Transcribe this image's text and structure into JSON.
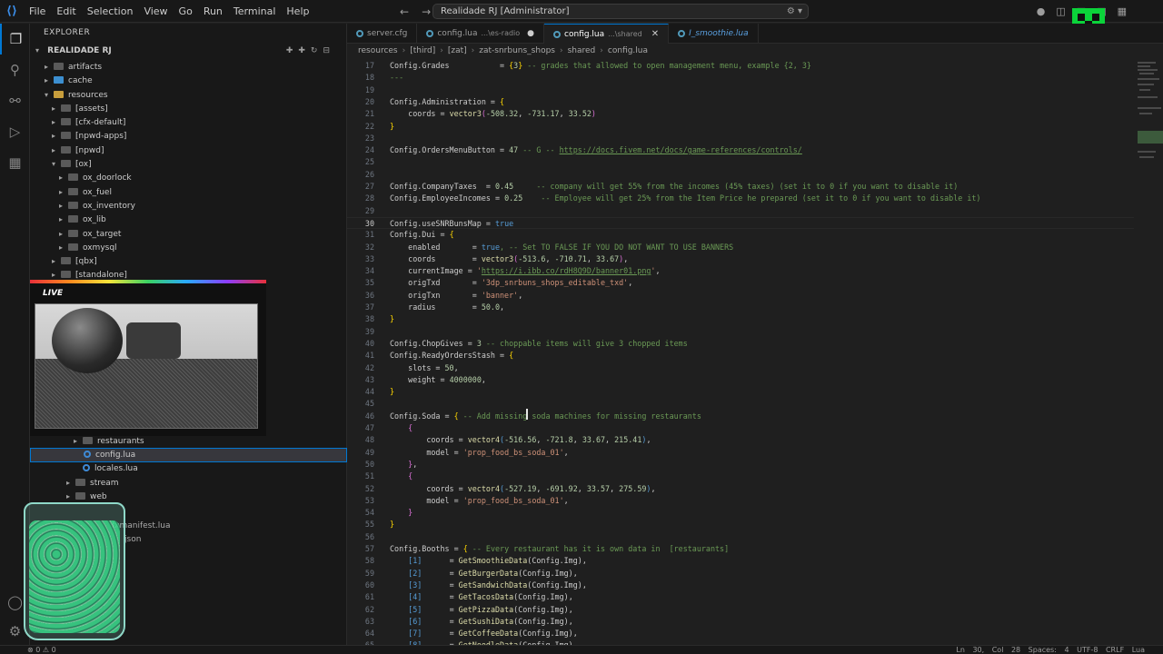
{
  "menu": [
    "File",
    "Edit",
    "Selection",
    "View",
    "Go",
    "Run",
    "Terminal",
    "Help"
  ],
  "window_title": "Realidade RJ [Administrator]",
  "explorer": {
    "title": "EXPLORER",
    "root": "REALIDADE RJ",
    "items": [
      {
        "label": "artifacts",
        "depth": 1,
        "kind": "folder",
        "open": false
      },
      {
        "label": "cache",
        "depth": 1,
        "kind": "folder-blue",
        "open": false
      },
      {
        "label": "resources",
        "depth": 1,
        "kind": "folder-open",
        "open": true
      },
      {
        "label": "[assets]",
        "depth": 2,
        "kind": "folder",
        "open": false
      },
      {
        "label": "[cfx-default]",
        "depth": 2,
        "kind": "folder",
        "open": false
      },
      {
        "label": "[npwd-apps]",
        "depth": 2,
        "kind": "folder",
        "open": false
      },
      {
        "label": "[npwd]",
        "depth": 2,
        "kind": "folder",
        "open": false
      },
      {
        "label": "[ox]",
        "depth": 2,
        "kind": "folder",
        "open": true
      },
      {
        "label": "ox_doorlock",
        "depth": 3,
        "kind": "folder",
        "open": false
      },
      {
        "label": "ox_fuel",
        "depth": 3,
        "kind": "folder",
        "open": false
      },
      {
        "label": "ox_inventory",
        "depth": 3,
        "kind": "folder",
        "open": false
      },
      {
        "label": "ox_lib",
        "depth": 3,
        "kind": "folder",
        "open": false
      },
      {
        "label": "ox_target",
        "depth": 3,
        "kind": "folder",
        "open": false
      },
      {
        "label": "oxmysql",
        "depth": 3,
        "kind": "folder",
        "open": false
      },
      {
        "label": "[qbx]",
        "depth": 2,
        "kind": "folder",
        "open": false
      },
      {
        "label": "[standalone]",
        "depth": 2,
        "kind": "folder",
        "open": false
      }
    ],
    "lower_items": [
      {
        "label": "restaurants",
        "depth": 5,
        "kind": "folder",
        "selected": false
      },
      {
        "label": "config.lua",
        "depth": 5,
        "kind": "lua",
        "selected": true
      },
      {
        "label": "locales.lua",
        "depth": 5,
        "kind": "lua",
        "selected": false
      },
      {
        "label": "stream",
        "depth": 4,
        "kind": "folder",
        "selected": false
      },
      {
        "label": "web",
        "depth": 4,
        "kind": "folder",
        "selected": false
      }
    ],
    "partial_items": [
      "fxmanifest.lua",
      "json"
    ]
  },
  "webcam": {
    "label": "LIVE"
  },
  "tabs": [
    {
      "name": "server.cfg",
      "sub": "",
      "active": false,
      "modified": false,
      "preview": false
    },
    {
      "name": "config.lua",
      "sub": "...\\es-radio",
      "active": false,
      "modified": true,
      "preview": false
    },
    {
      "name": "config.lua",
      "sub": "...\\shared",
      "active": true,
      "modified": false,
      "preview": false
    },
    {
      "name": "I_smoothie.lua",
      "sub": "",
      "active": false,
      "modified": false,
      "preview": true
    }
  ],
  "breadcrumbs": [
    "resources",
    "[third]",
    "[zat]",
    "zat-snrbuns_shops",
    "shared",
    "config.lua"
  ],
  "current_line": 30,
  "code": [
    {
      "n": 17,
      "t": [
        [
          "Config.Grades           = ",
          "k"
        ],
        [
          "{",
          "br"
        ],
        [
          "3",
          "n"
        ],
        [
          "}",
          "br"
        ],
        [
          " -- grades that allowed to open management menu, example {2, 3}",
          "c"
        ]
      ]
    },
    {
      "n": 18,
      "t": [
        [
          "---",
          "c"
        ]
      ]
    },
    {
      "n": 19,
      "t": []
    },
    {
      "n": 20,
      "t": [
        [
          "Config.Administration = ",
          "k"
        ],
        [
          "{",
          "br"
        ]
      ]
    },
    {
      "n": 21,
      "t": [
        [
          "    coords = ",
          "k"
        ],
        [
          "vector3",
          "f"
        ],
        [
          "(",
          "bp"
        ],
        [
          "-508.32",
          "n"
        ],
        [
          ", ",
          "k"
        ],
        [
          "-731.17",
          "n"
        ],
        [
          ", ",
          "k"
        ],
        [
          "33.52",
          "n"
        ],
        [
          ")",
          "bp"
        ]
      ]
    },
    {
      "n": 22,
      "t": [
        [
          "}",
          "br"
        ]
      ]
    },
    {
      "n": 23,
      "t": []
    },
    {
      "n": 24,
      "t": [
        [
          "Config.OrdersMenuButton = ",
          "k"
        ],
        [
          "47",
          "n"
        ],
        [
          " -- G -- ",
          "c"
        ],
        [
          "https://docs.fivem.net/docs/game-references/controls/",
          "l"
        ]
      ]
    },
    {
      "n": 25,
      "t": []
    },
    {
      "n": 26,
      "t": []
    },
    {
      "n": 27,
      "t": [
        [
          "Config.CompanyTaxes  = ",
          "k"
        ],
        [
          "0.45",
          "n"
        ],
        [
          "     -- company will get 55% from the incomes (45% taxes) (set it to 0 if you want to disable it)",
          "c"
        ]
      ]
    },
    {
      "n": 28,
      "t": [
        [
          "Config.EmployeeIncomes = ",
          "k"
        ],
        [
          "0.25",
          "n"
        ],
        [
          "    -- Employee will get 25% from the Item Price he prepared (set it to 0 if you want to disable it)",
          "c"
        ]
      ]
    },
    {
      "n": 29,
      "t": []
    },
    {
      "n": 30,
      "t": [
        [
          "Config.useSNRBunsMap = ",
          "k"
        ],
        [
          "true",
          "b"
        ]
      ]
    },
    {
      "n": 31,
      "t": [
        [
          "Config.Dui = ",
          "k"
        ],
        [
          "{",
          "br"
        ]
      ]
    },
    {
      "n": 32,
      "t": [
        [
          "    enabled       = ",
          "k"
        ],
        [
          "true",
          "b"
        ],
        [
          ", -- Set TO FALSE IF YOU DO NOT WANT TO USE BANNERS",
          "c"
        ]
      ]
    },
    {
      "n": 33,
      "t": [
        [
          "    coords        = ",
          "k"
        ],
        [
          "vector3",
          "f"
        ],
        [
          "(",
          "bp"
        ],
        [
          "-513.6",
          "n"
        ],
        [
          ", ",
          "k"
        ],
        [
          "-710.71",
          "n"
        ],
        [
          ", ",
          "k"
        ],
        [
          "33.67",
          "n"
        ],
        [
          ")",
          "bp"
        ],
        [
          ",",
          "k"
        ]
      ]
    },
    {
      "n": 34,
      "t": [
        [
          "    currentImage = ",
          "k"
        ],
        [
          "'",
          "s"
        ],
        [
          "https://i.ibb.co/rdH8Q9D/banner01.png",
          "l"
        ],
        [
          "'",
          "s"
        ],
        [
          ",",
          "k"
        ]
      ]
    },
    {
      "n": 35,
      "t": [
        [
          "    origTxd       = ",
          "k"
        ],
        [
          "'3dp_snrbuns_shops_editable_txd'",
          "s"
        ],
        [
          ",",
          "k"
        ]
      ]
    },
    {
      "n": 36,
      "t": [
        [
          "    origTxn       = ",
          "k"
        ],
        [
          "'banner'",
          "s"
        ],
        [
          ",",
          "k"
        ]
      ]
    },
    {
      "n": 37,
      "t": [
        [
          "    radius        = ",
          "k"
        ],
        [
          "50.0",
          "n"
        ],
        [
          ",",
          "k"
        ]
      ]
    },
    {
      "n": 38,
      "t": [
        [
          "}",
          "br"
        ]
      ]
    },
    {
      "n": 39,
      "t": []
    },
    {
      "n": 40,
      "t": [
        [
          "Config.ChopGives = ",
          "k"
        ],
        [
          "3",
          "n"
        ],
        [
          " -- choppable items will give 3 chopped items",
          "c"
        ]
      ]
    },
    {
      "n": 41,
      "t": [
        [
          "Config.ReadyOrdersStash = ",
          "k"
        ],
        [
          "{",
          "br"
        ]
      ]
    },
    {
      "n": 42,
      "t": [
        [
          "    slots = ",
          "k"
        ],
        [
          "50",
          "n"
        ],
        [
          ",",
          "k"
        ]
      ]
    },
    {
      "n": 43,
      "t": [
        [
          "    weight = ",
          "k"
        ],
        [
          "4000000",
          "n"
        ],
        [
          ",",
          "k"
        ]
      ]
    },
    {
      "n": 44,
      "t": [
        [
          "}",
          "br"
        ]
      ]
    },
    {
      "n": 45,
      "t": []
    },
    {
      "n": 46,
      "t": [
        [
          "Config.Soda = ",
          "k"
        ],
        [
          "{",
          "br"
        ],
        [
          " -- Add missing soda machines for missing restaurants",
          "c"
        ]
      ]
    },
    {
      "n": 47,
      "t": [
        [
          "    ",
          "k"
        ],
        [
          "{",
          "bp"
        ]
      ]
    },
    {
      "n": 48,
      "t": [
        [
          "        coords = ",
          "k"
        ],
        [
          "vector4",
          "f"
        ],
        [
          "(",
          "p"
        ],
        [
          "-516.56",
          "n"
        ],
        [
          ", ",
          "k"
        ],
        [
          "-721.8",
          "n"
        ],
        [
          ", ",
          "k"
        ],
        [
          "33.67",
          "n"
        ],
        [
          ", ",
          "k"
        ],
        [
          "215.41",
          "n"
        ],
        [
          ")",
          "p"
        ],
        [
          ",",
          "k"
        ]
      ]
    },
    {
      "n": 49,
      "t": [
        [
          "        model = ",
          "k"
        ],
        [
          "'prop_food_bs_soda_01'",
          "s"
        ],
        [
          ",",
          "k"
        ]
      ]
    },
    {
      "n": 50,
      "t": [
        [
          "    ",
          "k"
        ],
        [
          "}",
          "bp"
        ],
        [
          ",",
          "k"
        ]
      ]
    },
    {
      "n": 51,
      "t": [
        [
          "    ",
          "k"
        ],
        [
          "{",
          "bp"
        ]
      ]
    },
    {
      "n": 52,
      "t": [
        [
          "        coords = ",
          "k"
        ],
        [
          "vector4",
          "f"
        ],
        [
          "(",
          "p"
        ],
        [
          "-527.19",
          "n"
        ],
        [
          ", ",
          "k"
        ],
        [
          "-691.92",
          "n"
        ],
        [
          ", ",
          "k"
        ],
        [
          "33.57",
          "n"
        ],
        [
          ", ",
          "k"
        ],
        [
          "275.59",
          "n"
        ],
        [
          ")",
          "p"
        ],
        [
          ",",
          "k"
        ]
      ]
    },
    {
      "n": 53,
      "t": [
        [
          "        model = ",
          "k"
        ],
        [
          "'prop_food_bs_soda_01'",
          "s"
        ],
        [
          ",",
          "k"
        ]
      ]
    },
    {
      "n": 54,
      "t": [
        [
          "    ",
          "k"
        ],
        [
          "}",
          "bp"
        ]
      ]
    },
    {
      "n": 55,
      "t": [
        [
          "}",
          "br"
        ]
      ]
    },
    {
      "n": 56,
      "t": []
    },
    {
      "n": 57,
      "t": [
        [
          "Config.Booths = ",
          "k"
        ],
        [
          "{",
          "br"
        ],
        [
          " -- Every restaurant has it is own data in  [restaurants]",
          "c"
        ]
      ]
    },
    {
      "n": 58,
      "t": [
        [
          "    ",
          "k"
        ],
        [
          "[1]",
          "b"
        ],
        [
          "      = ",
          "k"
        ],
        [
          "GetSmoothieData",
          "f"
        ],
        [
          "(Config.Img)",
          "k"
        ],
        [
          ",",
          "k"
        ]
      ]
    },
    {
      "n": 59,
      "t": [
        [
          "    ",
          "k"
        ],
        [
          "[2]",
          "b"
        ],
        [
          "      = ",
          "k"
        ],
        [
          "GetBurgerData",
          "f"
        ],
        [
          "(Config.Img)",
          "k"
        ],
        [
          ",",
          "k"
        ]
      ]
    },
    {
      "n": 60,
      "t": [
        [
          "    ",
          "k"
        ],
        [
          "[3]",
          "b"
        ],
        [
          "      = ",
          "k"
        ],
        [
          "GetSandwichData",
          "f"
        ],
        [
          "(Config.Img)",
          "k"
        ],
        [
          ",",
          "k"
        ]
      ]
    },
    {
      "n": 61,
      "t": [
        [
          "    ",
          "k"
        ],
        [
          "[4]",
          "b"
        ],
        [
          "      = ",
          "k"
        ],
        [
          "GetTacosData",
          "f"
        ],
        [
          "(Config.Img)",
          "k"
        ],
        [
          ",",
          "k"
        ]
      ]
    },
    {
      "n": 62,
      "t": [
        [
          "    ",
          "k"
        ],
        [
          "[5]",
          "b"
        ],
        [
          "      = ",
          "k"
        ],
        [
          "GetPizzaData",
          "f"
        ],
        [
          "(Config.Img)",
          "k"
        ],
        [
          ",",
          "k"
        ]
      ]
    },
    {
      "n": 63,
      "t": [
        [
          "    ",
          "k"
        ],
        [
          "[6]",
          "b"
        ],
        [
          "      = ",
          "k"
        ],
        [
          "GetSushiData",
          "f"
        ],
        [
          "(Config.Img)",
          "k"
        ],
        [
          ",",
          "k"
        ]
      ]
    },
    {
      "n": 64,
      "t": [
        [
          "    ",
          "k"
        ],
        [
          "[7]",
          "b"
        ],
        [
          "      = ",
          "k"
        ],
        [
          "GetCoffeeData",
          "f"
        ],
        [
          "(Config.Img)",
          "k"
        ],
        [
          ",",
          "k"
        ]
      ]
    },
    {
      "n": 65,
      "t": [
        [
          "    ",
          "k"
        ],
        [
          "[8]",
          "b"
        ],
        [
          "      = ",
          "k"
        ],
        [
          "GetNoodleData",
          "f"
        ],
        [
          "(Config.Img)",
          "k"
        ]
      ]
    }
  ],
  "status": {
    "left": "⊗ 0 ⚠ 0",
    "right": "Ln 30, Col 28   Spaces: 4   UTF-8   CRLF   Lua"
  }
}
